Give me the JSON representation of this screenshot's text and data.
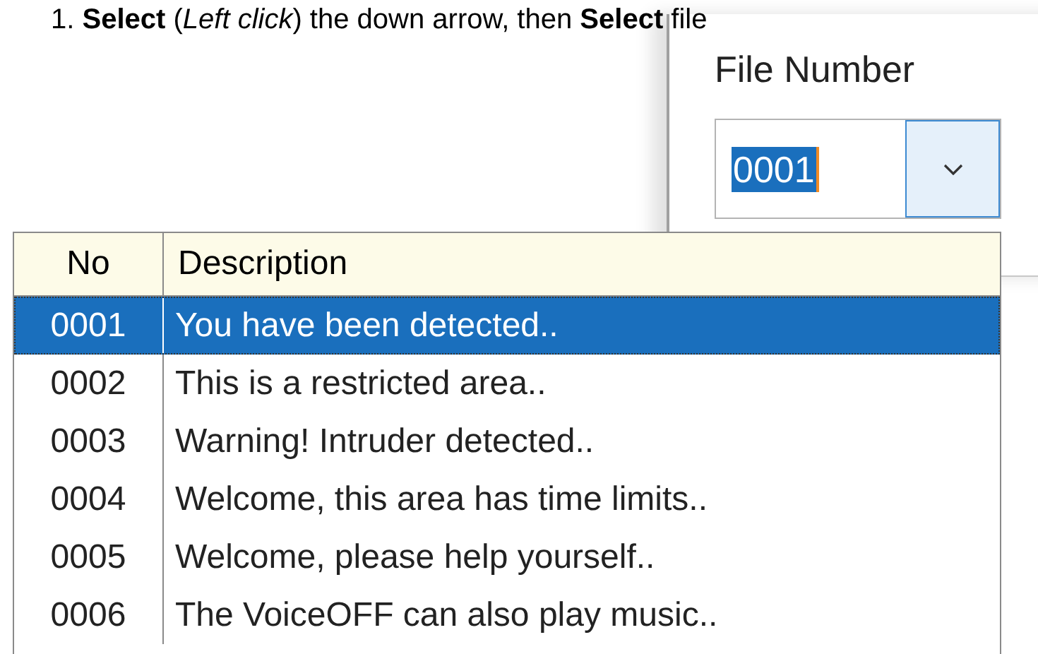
{
  "instruction": "1. **Select** (*Left click*) the down arrow, then **Select** file",
  "window": {
    "label": "File Number",
    "combo": {
      "value": "0001"
    }
  },
  "dropdown": {
    "columns": [
      "No",
      "Description"
    ],
    "rows": [
      {
        "no": "0001",
        "description": "You have been detected..",
        "selected": true
      },
      {
        "no": "0002",
        "description": "This is a restricted area..",
        "selected": false
      },
      {
        "no": "0003",
        "description": "Warning! Intruder detected..",
        "selected": false
      },
      {
        "no": "0004",
        "description": "Welcome, this area has time limits..",
        "selected": false
      },
      {
        "no": "0005",
        "description": "Welcome, please help yourself..",
        "selected": false
      },
      {
        "no": "0006",
        "description": "The VoiceOFF can also play music..",
        "selected": false
      }
    ]
  }
}
